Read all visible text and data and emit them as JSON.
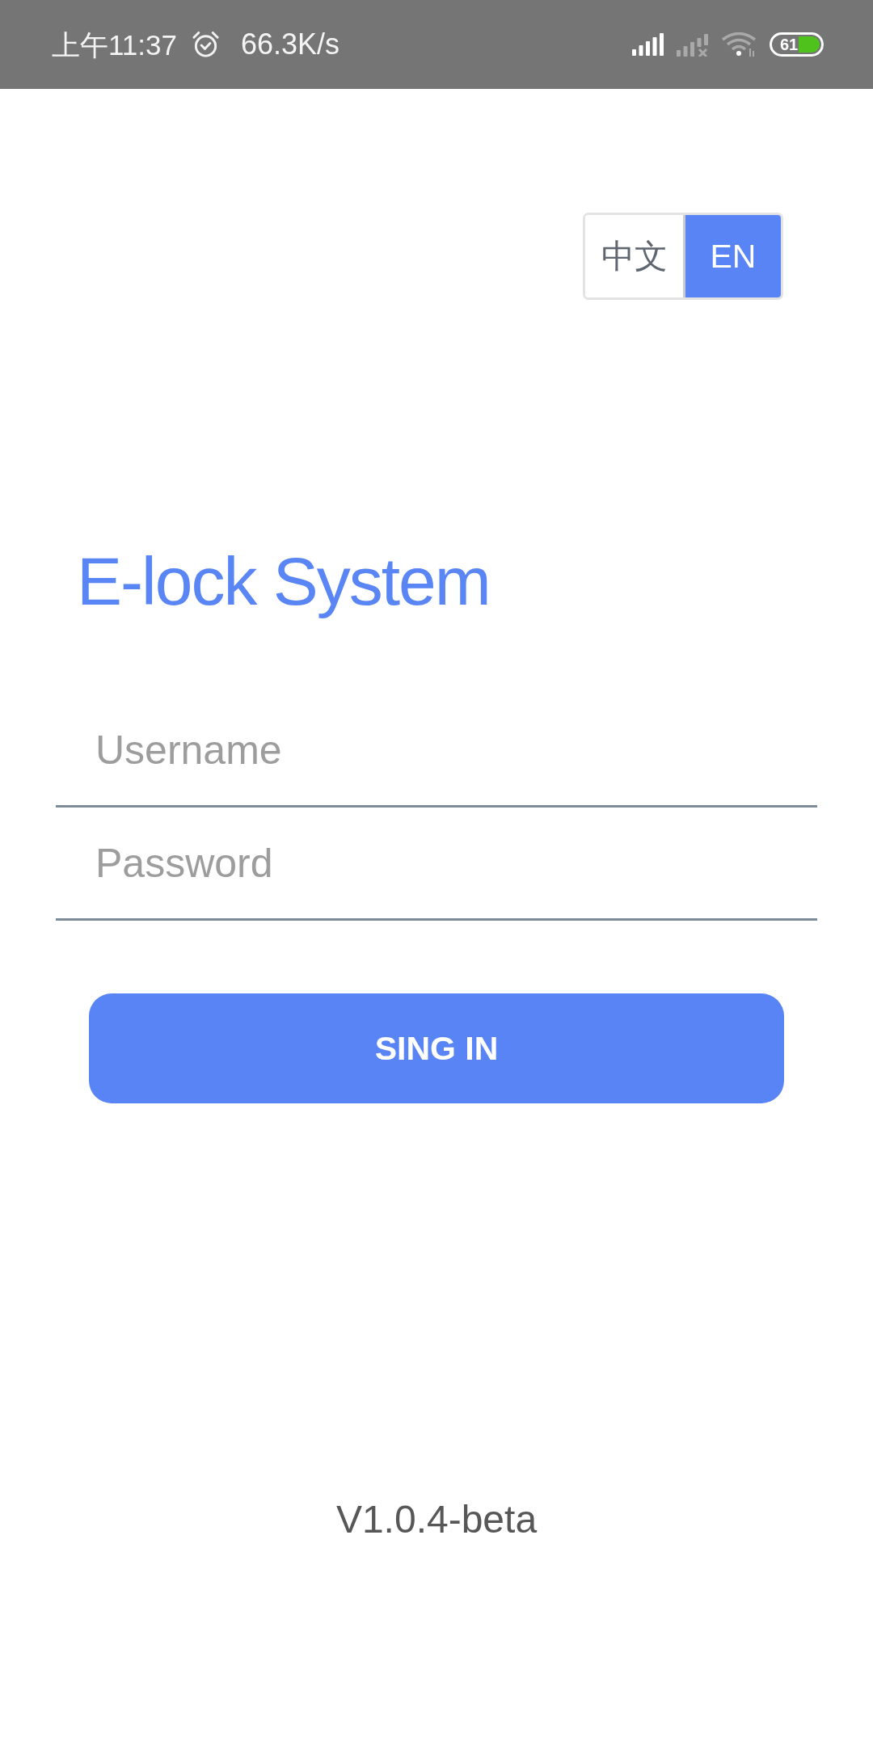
{
  "status_bar": {
    "time": "上午11:37",
    "network_speed": "66.3K/s",
    "battery": "61"
  },
  "language_toggle": [
    {
      "label": "中文",
      "selected": false
    },
    {
      "label": "EN",
      "selected": true
    }
  ],
  "title": "E-lock System",
  "fields": [
    {
      "placeholder": "Username"
    },
    {
      "placeholder": "Password"
    }
  ],
  "sign_in_button": "SING IN",
  "version": "V1.0.4-beta"
}
